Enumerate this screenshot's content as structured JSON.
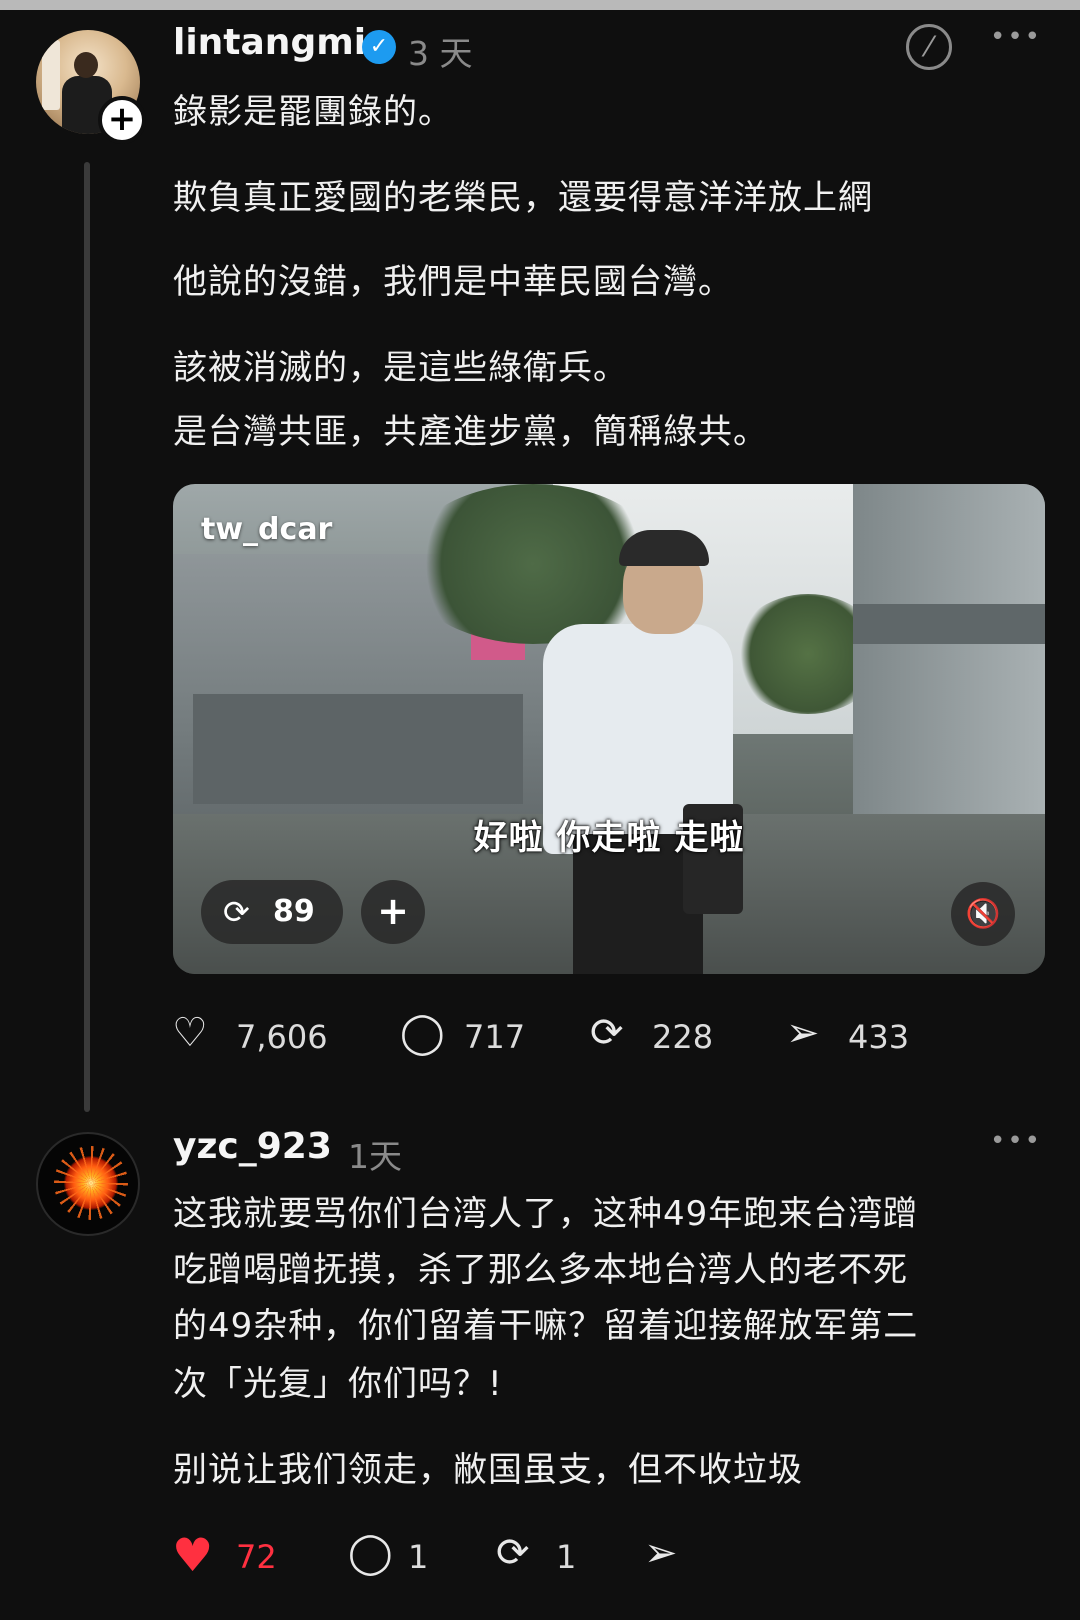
{
  "post": {
    "username": "lintangmi",
    "verified_icon": "check",
    "time": "3 天",
    "follow_symbol": "+",
    "more_symbol": "•••",
    "edit_icon": "edit-circle-icon",
    "lines": [
      "錄影是罷團錄的。",
      "欺負真正愛國的老榮民，還要得意洋洋放上網",
      "他說的沒錯，我們是中華民國台灣。",
      "該被消滅的，是這些綠衛兵。",
      "是台灣共匪，共產進步黨，簡稱綠共。"
    ],
    "video": {
      "tag": "tw_dcar",
      "subtitle": "好啦 你走啦 走啦",
      "repost_count": "89",
      "plus_symbol": "+",
      "mute_symbol": "🔇"
    },
    "actions": {
      "likes": "7,606",
      "comments": "717",
      "reposts": "228",
      "shares": "433"
    }
  },
  "reply": {
    "username": "yzc_923",
    "time": "1天",
    "more_symbol": "•••",
    "lines": [
      "这我就要骂你们台湾人了，这种49年跑来台湾蹭",
      "吃蹭喝蹭抚摸，杀了那么多本地台湾人的老不死",
      "的49杂种，你们留着干嘛？留着迎接解放军第二",
      "次「光复」你们吗？!",
      "别说让我们领走，敝国虽支，但不收垃圾"
    ],
    "actions": {
      "likes": "72",
      "comments": "1",
      "reposts": "1"
    },
    "like_color": "#ff3040"
  }
}
